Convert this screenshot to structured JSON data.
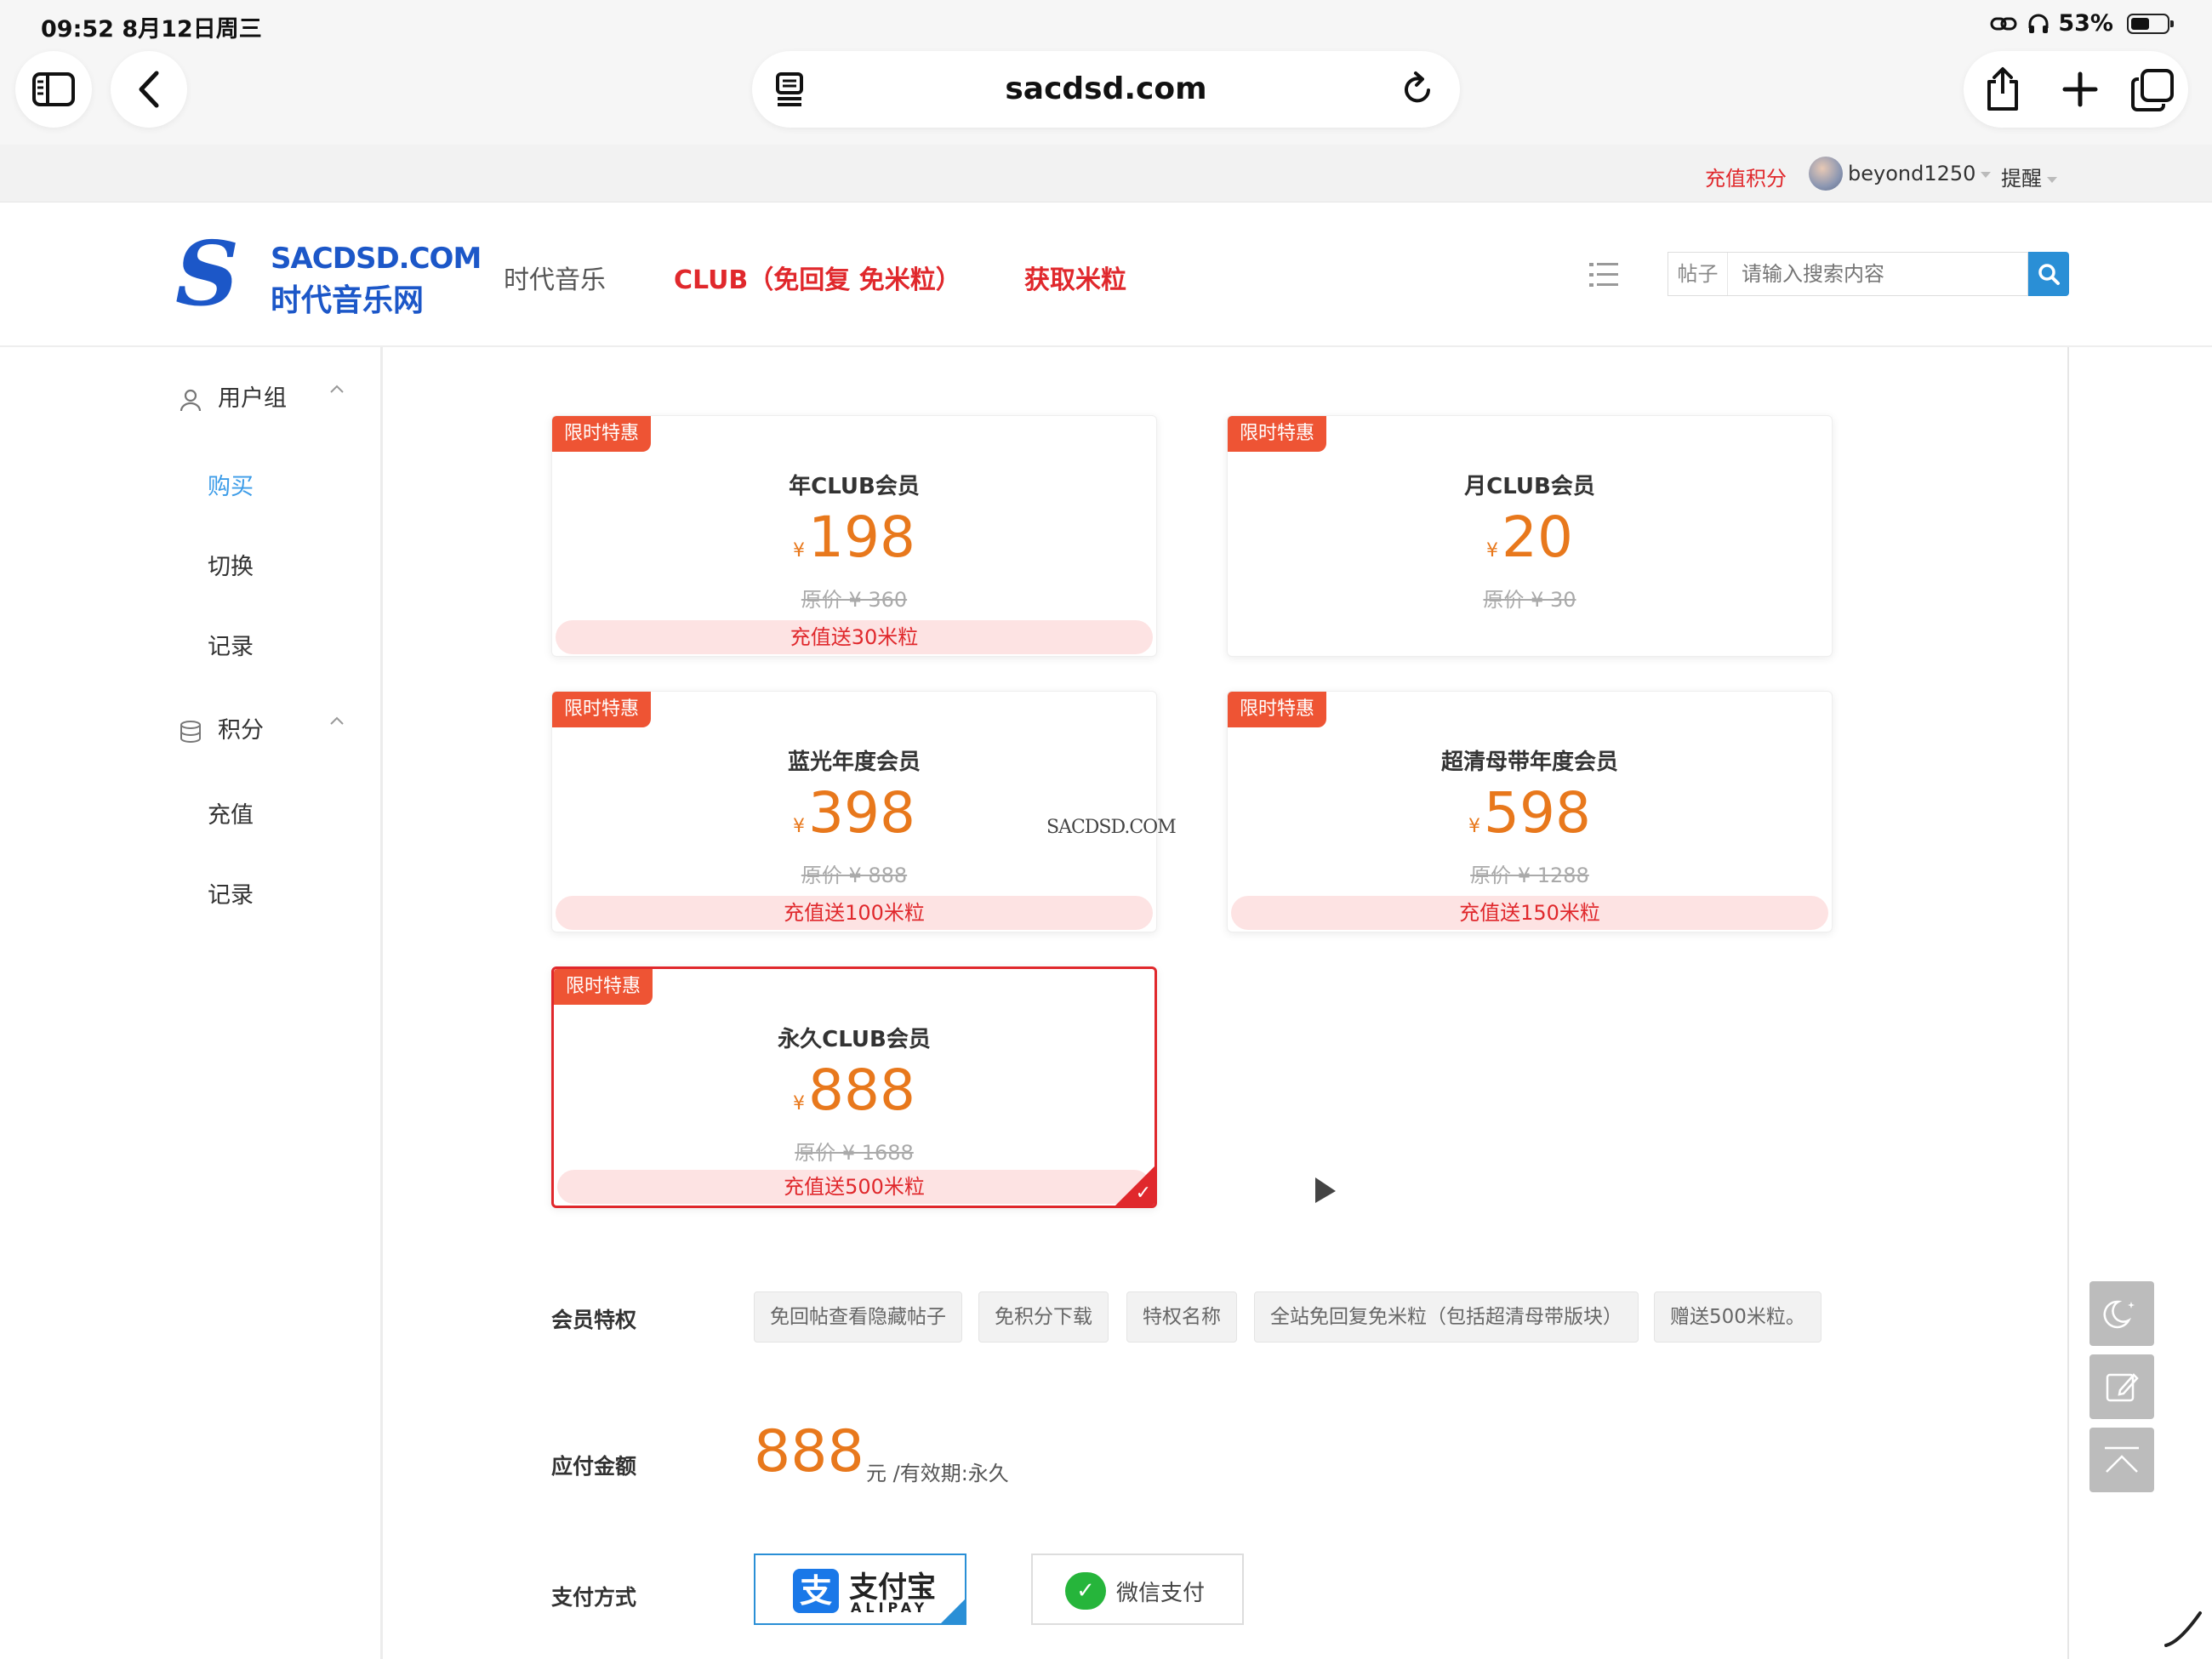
{
  "status_bar": {
    "time": "09:52  8月12日周三",
    "battery_percent": "53%",
    "battery_level": 0.53
  },
  "browser": {
    "url": "sacdsd.com"
  },
  "topbar": {
    "recharge_label": "充值积分",
    "username": "beyond1250",
    "remind_label": "提醒"
  },
  "header": {
    "logo": {
      "line1": "SACDSD.COM",
      "line2": "时代音乐网"
    },
    "nav": [
      "时代音乐",
      "CLUB（免回复 免米粒）",
      "获取米粒"
    ],
    "search": {
      "scope": "帖子",
      "placeholder": "请输入搜索内容"
    }
  },
  "sidebar": {
    "groups": [
      {
        "label": "用户组",
        "items": [
          "购买",
          "切换",
          "记录"
        ],
        "active": "购买"
      },
      {
        "label": "积分",
        "items": [
          "充值",
          "记录"
        ]
      }
    ]
  },
  "plans": [
    {
      "tag": "限时特惠",
      "name": "年CLUB会员",
      "currency": "¥",
      "price": "198",
      "original": "原价 ¥ 360",
      "bonus": "充值送30米粒",
      "selected": false
    },
    {
      "tag": "限时特惠",
      "name": "月CLUB会员",
      "currency": "¥",
      "price": "20",
      "original": "原价 ¥ 30",
      "bonus": "",
      "selected": false
    },
    {
      "tag": "限时特惠",
      "name": "蓝光年度会员",
      "currency": "¥",
      "price": "398",
      "original": "原价 ¥ 888",
      "bonus": "充值送100米粒",
      "selected": false
    },
    {
      "tag": "限时特惠",
      "name": "超清母带年度会员",
      "currency": "¥",
      "price": "598",
      "original": "原价 ¥ 1288",
      "bonus": "充值送150米粒",
      "selected": false
    },
    {
      "tag": "限时特惠",
      "name": "永久CLUB会员",
      "currency": "¥",
      "price": "888",
      "original": "原价 ¥ 1688",
      "bonus": "充值送500米粒",
      "selected": true
    }
  ],
  "watermark": "SACDSD.COM",
  "privileges": {
    "label": "会员特权",
    "items": [
      "免回帖查看隐藏帖子",
      "免积分下载",
      "特权名称",
      "全站免回复免米粒（包括超清母带版块）",
      "赠送500米粒。"
    ]
  },
  "payment_amount": {
    "label": "应付金额",
    "amount": "888",
    "suffix": "元 /有效期:永久"
  },
  "payment_method": {
    "label": "支付方式",
    "options": [
      {
        "name": "支付宝",
        "sub": "ALIPAY",
        "selected": true
      },
      {
        "name": "微信支付",
        "selected": false
      }
    ]
  },
  "colors": {
    "accent_red": "#e0282c",
    "price_orange": "#e8781c",
    "link_blue": "#3c9ce8",
    "search_blue": "#2a8fd6"
  },
  "icons": {
    "browser": [
      "sidebar-icon",
      "back-icon",
      "reader-icon",
      "reload-icon",
      "share-icon",
      "plus-icon",
      "tabs-icon"
    ],
    "floating": [
      "moon-icon",
      "edit-icon",
      "back-to-top-icon"
    ]
  }
}
